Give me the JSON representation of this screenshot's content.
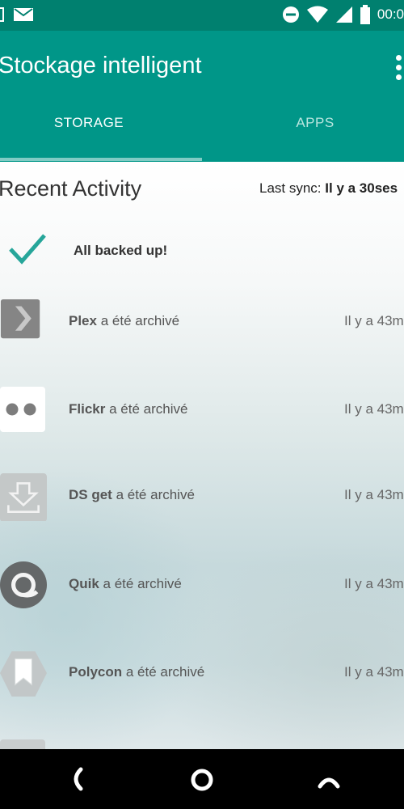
{
  "status_bar": {
    "time": "00:0",
    "icons": [
      "image-notification-icon",
      "mail-icon",
      "do-not-disturb-icon",
      "wifi-icon",
      "signal-icon",
      "battery-icon"
    ]
  },
  "app_bar": {
    "title": "Stockage intelligent",
    "tabs": [
      {
        "label": "STORAGE",
        "selected": true
      },
      {
        "label": "APPS",
        "selected": false
      }
    ]
  },
  "recent_activity": {
    "title": "Recent Activity",
    "last_sync_label": "Last sync:",
    "last_sync_value": "Il y a 30ses",
    "backed_up_text": "All backed up!",
    "items": [
      {
        "app": "Plex",
        "suffix": "a été archivé",
        "time": "Il y a 43m",
        "icon": "plex-icon"
      },
      {
        "app": "Flickr",
        "suffix": "a été archivé",
        "time": "Il y a 43m",
        "icon": "flickr-icon"
      },
      {
        "app": "DS get",
        "suffix": "a été archivé",
        "time": "Il y a 43m",
        "icon": "ds-get-icon"
      },
      {
        "app": "Quik",
        "suffix": "a été archivé",
        "time": "Il y a 43m",
        "icon": "quik-icon"
      },
      {
        "app": "Polycon",
        "suffix": "a été archivé",
        "time": "Il y a 43m",
        "icon": "polycon-icon"
      }
    ]
  },
  "colors": {
    "app_bar": "#009688",
    "status_bar": "#00806f",
    "accent_check": "#26a69a",
    "tab_indicator": "#80cbc4"
  },
  "nav_bar": {
    "buttons": [
      "back-icon",
      "home-icon",
      "recents-icon"
    ]
  }
}
